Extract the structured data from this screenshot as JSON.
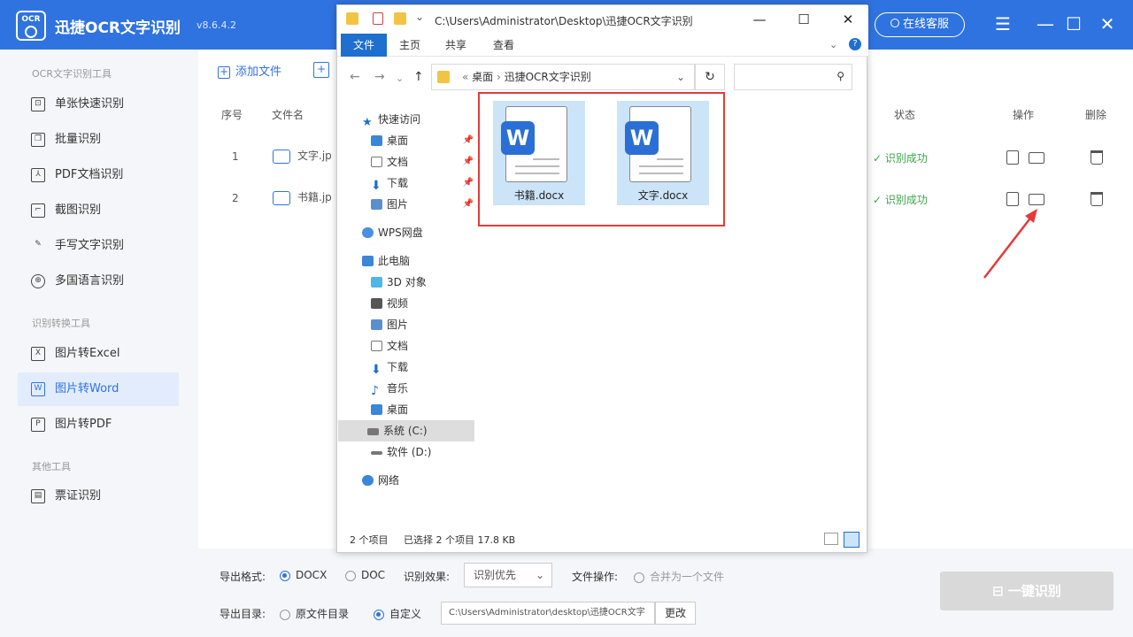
{
  "app": {
    "logo": "OCR",
    "title": "迅捷OCR文字识别",
    "version": "v8.6.4.2",
    "service_btn": "在线客服"
  },
  "sidebar": {
    "section1": "OCR文字识别工具",
    "items1": [
      "单张快速识别",
      "批量识别",
      "PDF文档识别",
      "截图识别",
      "手写文字识别",
      "多国语言识别"
    ],
    "section2": "识别转换工具",
    "items2": [
      "图片转Excel",
      "图片转Word",
      "图片转PDF"
    ],
    "section3": "其他工具",
    "items3": [
      "票证识别"
    ]
  },
  "main": {
    "add_file": "添加文件",
    "headers": {
      "index": "序号",
      "filename": "文件名",
      "status": "状态",
      "action": "操作",
      "delete": "删除"
    },
    "rows": [
      {
        "index": "1",
        "filename": "文字.jp",
        "status": "识别成功"
      },
      {
        "index": "2",
        "filename": "书籍.jp",
        "status": "识别成功"
      }
    ]
  },
  "bottom": {
    "export_format_label": "导出格式:",
    "fmt_docx": "DOCX",
    "fmt_doc": "DOC",
    "effect_label": "识别效果:",
    "effect_value": "识别优先",
    "file_op_label": "文件操作:",
    "merge_label": "合并为一个文件",
    "export_dir_label": "导出目录:",
    "dir_original": "原文件目录",
    "dir_custom": "自定义",
    "path_value": "C:\\Users\\Administrator\\desktop\\迅捷OCR文字",
    "change_btn": "更改",
    "start_btn": "一键识别"
  },
  "explorer": {
    "title_path": "C:\\Users\\Administrator\\Desktop\\迅捷OCR文字识别",
    "ribbon": [
      "文件",
      "主页",
      "共享",
      "查看"
    ],
    "address": [
      "桌面",
      "迅捷OCR文字识别"
    ],
    "nav": {
      "quick_access": "快速访问",
      "quick_items": [
        "桌面",
        "文档",
        "下载",
        "图片"
      ],
      "wps": "WPS网盘",
      "this_pc": "此电脑",
      "pc_items": [
        "3D 对象",
        "视频",
        "图片",
        "文档",
        "下载",
        "音乐",
        "桌面",
        "系统 (C:)",
        "软件 (D:)"
      ],
      "network": "网络"
    },
    "files": [
      "书籍.docx",
      "文字.docx"
    ],
    "status": {
      "count": "2 个项目",
      "selected": "已选择 2 个项目  17.8 KB"
    }
  }
}
